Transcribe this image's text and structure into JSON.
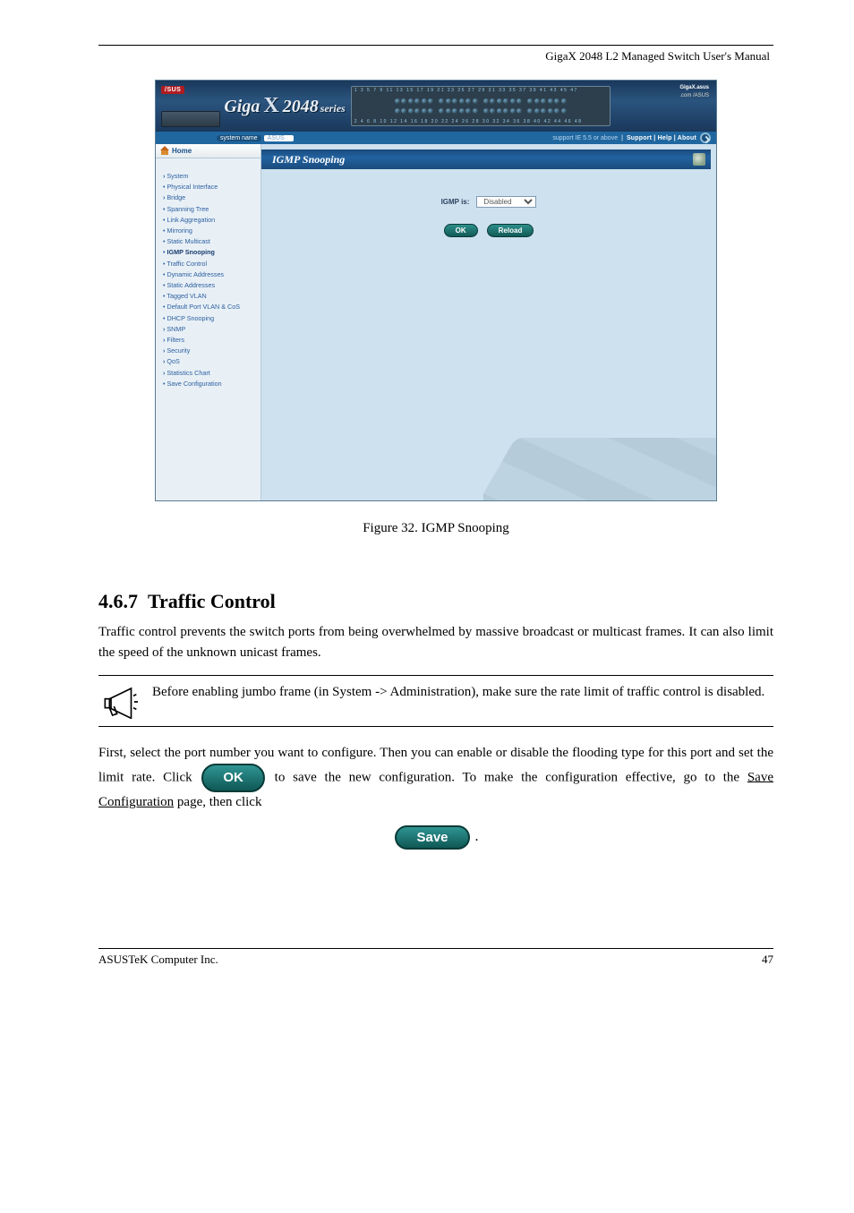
{
  "doc": {
    "header_right": "GigaX 2048 L2 Managed Switch User's Manual",
    "fig_caption": "Figure 32. IGMP Snooping",
    "section_number": "4.6.7",
    "section_title": "Traffic Control",
    "para1": "Traffic control prevents the switch ports from being overwhelmed by massive broadcast or multicast frames. It can also limit the speed of the unknown unicast frames.",
    "para2_a": "First, select the port number you want to configure. Then you can enable or disable the flooding type for this port and set the limit rate. Click ",
    "para2_b": " to save the new configuration. To make the configuration effective, go to the ",
    "para2_link": "Save Configuration",
    "para2_c": " page, then click ",
    "note_text": "Before enabling jumbo frame (in System -> Administration), make sure the rate limit of traffic control is disabled.",
    "footer_left": "ASUSTeK Computer Inc.",
    "footer_right": "47"
  },
  "btn": {
    "ok": "OK",
    "save": "Save"
  },
  "screenshot": {
    "brand": "/SUS",
    "product_giga": "Giga",
    "product_x": "X",
    "product_model": "2048",
    "product_series": "series",
    "link_brand": "GigaX.asus",
    "link_model": ".com /ASUS",
    "sysname_label": "system name",
    "sysname_value": "ASUS",
    "support_text": "support IE 5.5 or above",
    "nav_links": "Support | Help | About",
    "home": "Home",
    "banner_title": "IGMP Snooping",
    "form_label": "IGMP is:",
    "form_value": "Disabled",
    "btn_ok": "OK",
    "btn_reload": "Reload",
    "nav": [
      {
        "label": "System",
        "cls": "top"
      },
      {
        "label": "Physical Interface",
        "cls": "sub"
      },
      {
        "label": "Bridge",
        "cls": "top"
      },
      {
        "label": "Spanning Tree",
        "cls": "sub"
      },
      {
        "label": "Link Aggregation",
        "cls": "sub"
      },
      {
        "label": "Mirroring",
        "cls": "sub"
      },
      {
        "label": "Static Multicast",
        "cls": "sub"
      },
      {
        "label": "IGMP Snooping",
        "cls": "sub active"
      },
      {
        "label": "Traffic Control",
        "cls": "sub"
      },
      {
        "label": "Dynamic Addresses",
        "cls": "sub"
      },
      {
        "label": "Static Addresses",
        "cls": "sub"
      },
      {
        "label": "Tagged VLAN",
        "cls": "sub"
      },
      {
        "label": "Default Port VLAN & CoS",
        "cls": "sub"
      },
      {
        "label": "DHCP Snooping",
        "cls": "sub"
      },
      {
        "label": "SNMP",
        "cls": "top"
      },
      {
        "label": "Filters",
        "cls": "top"
      },
      {
        "label": "Security",
        "cls": "top"
      },
      {
        "label": "QoS",
        "cls": "top"
      },
      {
        "label": "Statistics Chart",
        "cls": "top"
      },
      {
        "label": "Save Configuration",
        "cls": "sub"
      }
    ],
    "port_top": "1  3  5  7  9  11  13  15  17  19  21  23     25  27  29  31  33  35     37  39  41  43  45  47",
    "port_bot": "2  4  6  8  10  12  14  16  18  20  22  24     26  28  30  32  34  36     38  40  42  44  46  48"
  }
}
